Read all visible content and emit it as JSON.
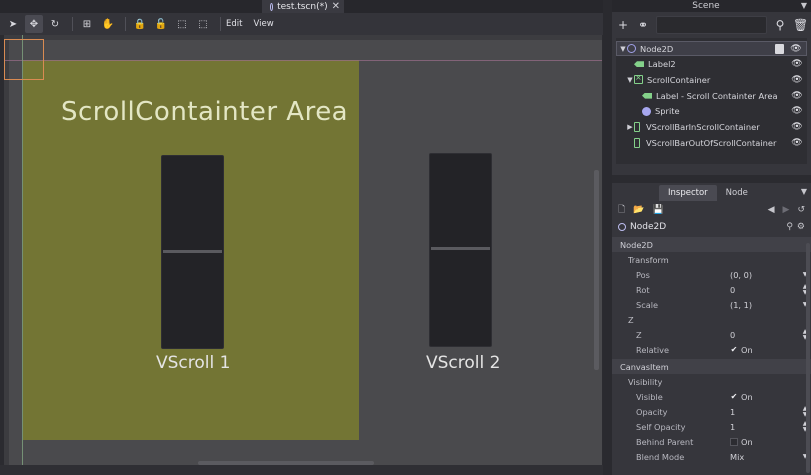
{
  "tabs": {
    "scene_tab": "test.tscn(*)",
    "close_glyph": "✕"
  },
  "docks": {
    "scene_title": "Scene",
    "menu_glyph": "▼"
  },
  "toolbar": {
    "tools": [
      {
        "name": "select-tool-icon",
        "glyph": "➤",
        "active": false
      },
      {
        "name": "move-tool-icon",
        "glyph": "✥",
        "active": true
      },
      {
        "name": "rotate-tool-icon",
        "glyph": "↻",
        "active": false
      },
      {
        "name": "edit-pivot-icon",
        "glyph": "⊞",
        "active": false
      },
      {
        "name": "pan-tool-icon",
        "glyph": "✋",
        "active": false
      },
      {
        "name": "lock-icon",
        "glyph": "🔒",
        "active": false
      },
      {
        "name": "unlock-icon",
        "glyph": "🔓",
        "active": false
      },
      {
        "name": "group-icon",
        "glyph": "⬚",
        "active": false
      },
      {
        "name": "ungroup-icon",
        "glyph": "⬚",
        "active": false
      }
    ],
    "menus": [
      "Edit",
      "View"
    ]
  },
  "viewport": {
    "area_title": "ScrollContainter Area",
    "vscroll1_label": "VScroll 1",
    "vscroll2_label": "VScroll 2",
    "colors": {
      "area": "#737534",
      "bg": "#4a4a4d"
    }
  },
  "scene": {
    "filter_placeholder": "",
    "nodes": [
      {
        "label": "Node2D",
        "icon": "node2d",
        "depth": 0,
        "arrow": "▼",
        "selected": true,
        "script": true
      },
      {
        "label": "Label2",
        "icon": "label",
        "depth": 1,
        "arrow": "",
        "selected": false
      },
      {
        "label": "ScrollContainer",
        "icon": "scroll",
        "depth": 1,
        "arrow": "▼",
        "selected": false
      },
      {
        "label": "Label - Scroll Containter Area",
        "icon": "label",
        "depth": 2,
        "arrow": "",
        "selected": false
      },
      {
        "label": "Sprite",
        "icon": "sprite",
        "depth": 2,
        "arrow": "",
        "selected": false
      },
      {
        "label": "VScrollBarInScrollContainer",
        "icon": "vbar",
        "depth": 1,
        "arrow": "▶",
        "selected": false
      },
      {
        "label": "VScrollBarOutOfScrollContainer",
        "icon": "vbar",
        "depth": 1,
        "arrow": "",
        "selected": false
      }
    ]
  },
  "inspector": {
    "tabs": [
      "Inspector",
      "Node"
    ],
    "object_name": "Node2D",
    "section_node2d": "Node2D",
    "cat_transform": "Transform",
    "pos_label": "Pos",
    "pos_value": "(0, 0)",
    "rot_label": "Rot",
    "rot_value": "0",
    "scale_label": "Scale",
    "scale_value": "(1, 1)",
    "cat_z": "Z",
    "z_label": "Z",
    "z_value": "0",
    "relative_label": "Relative",
    "relative_value": "On",
    "section_canvas": "CanvasItem",
    "cat_visibility": "Visibility",
    "visible_label": "Visible",
    "visible_value": "On",
    "opacity_label": "Opacity",
    "opacity_value": "1",
    "self_opacity_label": "Self Opacity",
    "self_opacity_value": "1",
    "behind_parent_label": "Behind Parent",
    "behind_parent_value": "On",
    "blend_mode_label": "Blend Mode",
    "blend_mode_value": "Mix"
  }
}
